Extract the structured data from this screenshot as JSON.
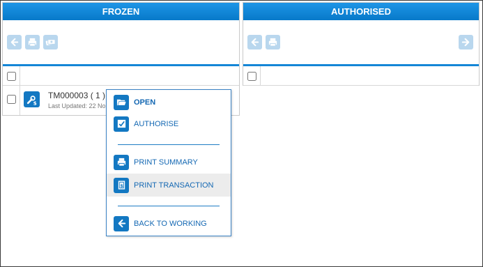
{
  "panels": {
    "frozen": {
      "title": "FROZEN"
    },
    "authorised": {
      "title": "AUTHORISED"
    }
  },
  "item": {
    "title": "TM000003 ( 1 )",
    "subtitle": "Last Updated: 22 No"
  },
  "context_menu": {
    "open": "OPEN",
    "authorise": "AUTHORISE",
    "print_summary": "PRINT SUMMARY",
    "print_transaction": "PRINT TRANSACTION",
    "back_to_working": "BACK TO WORKING"
  },
  "colors": {
    "header_blue": "#0a82d2",
    "disabled_button": "#b9d7ee",
    "menu_text": "#1468b3",
    "icon_blue": "#1378c2"
  },
  "icons": {
    "frozen_toolbar": [
      "back-arrow-icon",
      "print-icon",
      "money-icon"
    ],
    "authorised_toolbar": [
      "back-arrow-icon",
      "print-icon",
      "forward-arrow-icon"
    ],
    "item": "tools-dollar-icon"
  }
}
